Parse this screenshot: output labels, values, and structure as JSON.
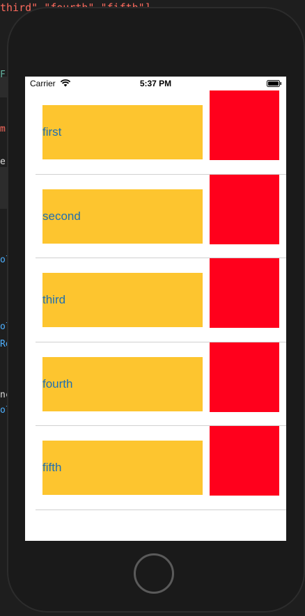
{
  "editor_fragments": {
    "top": "third\" \"fourth\" \"fifth\"]",
    "green": "Fr",
    "red2": "m",
    "white": "e.",
    "blue1": "ol",
    "blue2": "ol",
    "blue3": "Re",
    "white2": "nc",
    "blue4": "ol"
  },
  "status_bar": {
    "carrier": "Carrier",
    "time": "5:37 PM"
  },
  "rows": [
    {
      "label": "first"
    },
    {
      "label": "second"
    },
    {
      "label": "third"
    },
    {
      "label": "fourth"
    },
    {
      "label": "fifth"
    }
  ],
  "colors": {
    "label_background": "#fdc52f",
    "label_text": "#1f6fb0",
    "thumbnail": "#ff001c"
  },
  "icons": {
    "wifi": "wifi-icon",
    "battery": "battery-icon",
    "home": "home-button"
  }
}
